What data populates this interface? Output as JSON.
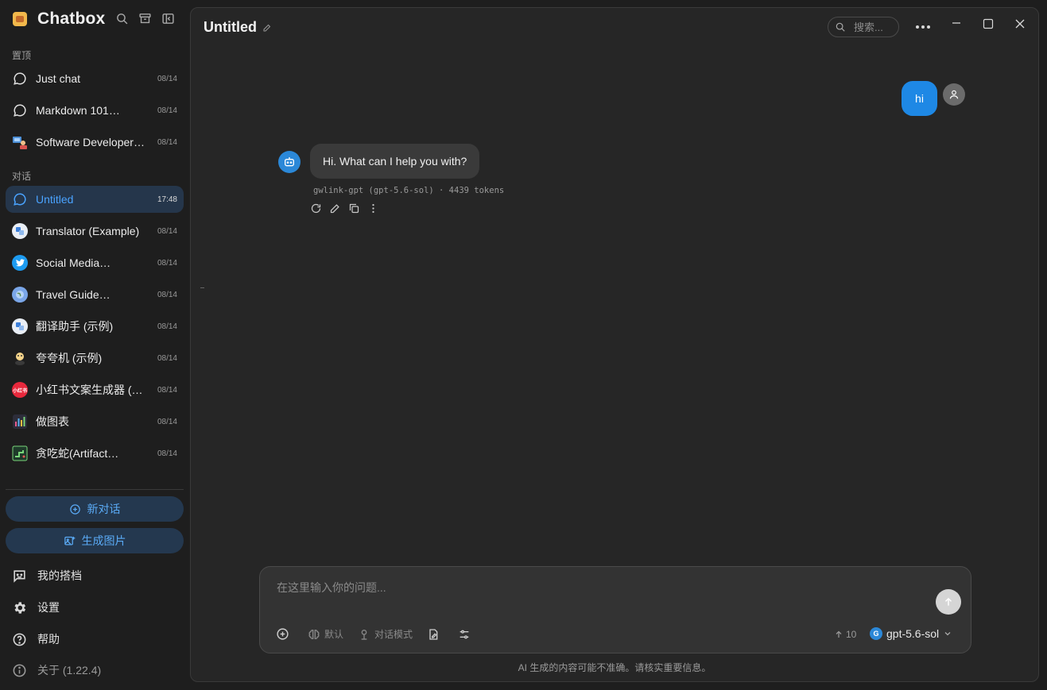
{
  "app": {
    "name": "Chatbox",
    "version_label": "关于 (1.22.4)"
  },
  "sidebar": {
    "pinned_label": "置顶",
    "conversations_label": "对话",
    "pinned": [
      {
        "title": "Just chat",
        "date": "08/14",
        "icon": "chat-bubble-icon"
      },
      {
        "title": "Markdown 101…",
        "date": "08/14",
        "icon": "chat-bubble-icon"
      },
      {
        "title": "Software Developer…",
        "date": "08/14",
        "icon": "developer-avatar-icon"
      }
    ],
    "conversations": [
      {
        "title": "Untitled",
        "date": "17:48",
        "icon": "chat-bubble-icon",
        "active": true
      },
      {
        "title": "Translator (Example)",
        "date": "08/14",
        "icon": "translator-avatar-icon"
      },
      {
        "title": "Social Media…",
        "date": "08/14",
        "icon": "twitter-bird-icon"
      },
      {
        "title": "Travel Guide…",
        "date": "08/14",
        "icon": "globe-avatar-icon"
      },
      {
        "title": "翻译助手 (示例)",
        "date": "08/14",
        "icon": "translator-avatar-icon"
      },
      {
        "title": "夸夸机 (示例)",
        "date": "08/14",
        "icon": "cheer-avatar-icon"
      },
      {
        "title": "小红书文案生成器 (…",
        "date": "08/14",
        "icon": "xiaohongshu-avatar-icon",
        "avatar_text": "小红书"
      },
      {
        "title": "做图表",
        "date": "08/14",
        "icon": "bar-chart-avatar-icon"
      },
      {
        "title": "贪吃蛇(Artifact…",
        "date": "08/14",
        "icon": "snake-game-avatar-icon"
      }
    ],
    "new_chat_label": "新对话",
    "generate_image_label": "生成图片",
    "my_partners_label": "我的搭档",
    "settings_label": "设置",
    "help_label": "帮助"
  },
  "header": {
    "title": "Untitled",
    "search_placeholder": "搜索..."
  },
  "messages": {
    "user_text": "hi",
    "assistant_text": "Hi. What can I help you with?",
    "assistant_meta": "gwlink-gpt (gpt-5.6-sol) · 4439 tokens"
  },
  "composer": {
    "placeholder": "在这里输入你的问题...",
    "default_label": "默认",
    "chat_mode_label": "对话模式",
    "context_count": "10",
    "model_badge": "G",
    "model_name": "gpt-5.6-sol"
  },
  "footer": {
    "disclaimer": "AI 生成的内容可能不准确。请核实重要信息。"
  },
  "colors": {
    "accent": "#1e88e5",
    "active_item_bg": "#25364b",
    "sidebar_bg": "#1e1e1e",
    "panel_bg": "#262626"
  }
}
